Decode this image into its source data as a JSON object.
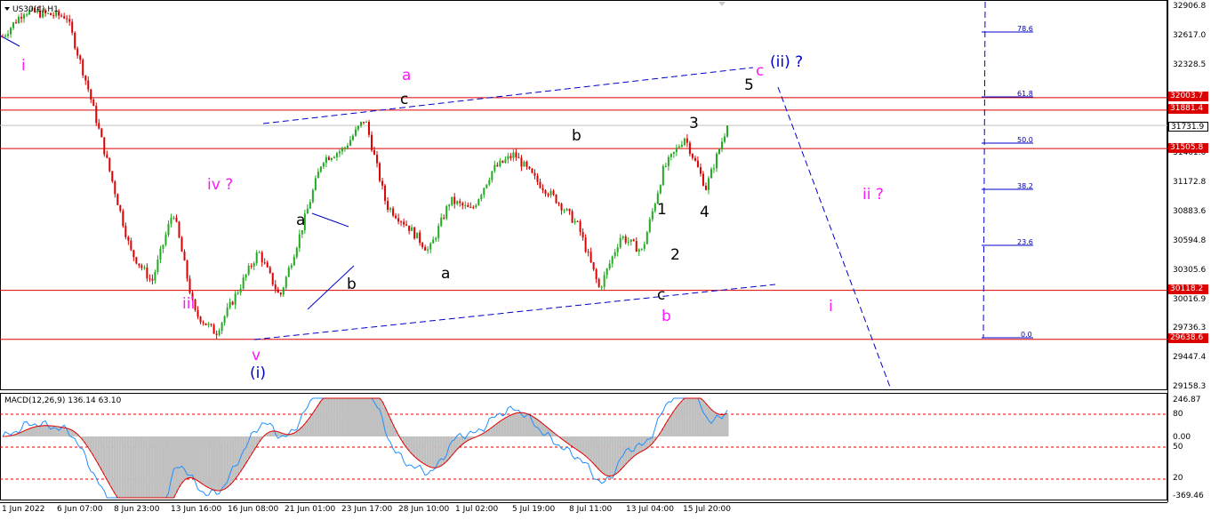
{
  "window": {
    "symbol_title": "US30(€),H1"
  },
  "price_axis": {
    "ticks": [
      "32906.8",
      "32617.0",
      "32328.5",
      "31461.6",
      "31172.8",
      "30883.6",
      "30594.8",
      "30305.6",
      "30016.9",
      "29736.3",
      "29447.4",
      "29158.3"
    ],
    "tags": [
      {
        "text": "32003.7",
        "color": "#dd0000"
      },
      {
        "text": "31881.4",
        "color": "#dd0000"
      },
      {
        "text": "31731.9",
        "color": "#ffffff",
        "text_color": "#000000"
      },
      {
        "text": "31505.8",
        "color": "#dd0000"
      },
      {
        "text": "30118.2",
        "color": "#dd0000"
      },
      {
        "text": "29638.6",
        "color": "#dd0000"
      }
    ]
  },
  "time_axis": {
    "ticks": [
      "1 Jun 2022",
      "6 Jun 07:00",
      "8 Jun 23:00",
      "13 Jun 16:00",
      "16 Jun 08:00",
      "21 Jun 01:00",
      "23 Jun 17:00",
      "28 Jun 10:00",
      "1 Jul 02:00",
      "5 Jul 19:00",
      "8 Jul 11:00",
      "13 Jul 04:00",
      "15 Jul 20:00"
    ]
  },
  "fibonacci": {
    "levels": [
      "78.6",
      "61.8",
      "50.0",
      "38.2",
      "23.6",
      "0.0"
    ]
  },
  "macd": {
    "title": "MACD(12,26,9) 136.14 63.10",
    "ticks": [
      "246.87",
      "80",
      "0.00",
      "50",
      "20",
      "-369.46"
    ]
  },
  "wave_labels": {
    "i_top": "i",
    "iii": "iii",
    "iv_q": "iv ?",
    "v": "v",
    "wave_i_paren": "(i)",
    "a_small_1": "a",
    "b_small_1": "b",
    "a_m": "a",
    "c_top": "c",
    "a_small_2": "a",
    "b_mid": "b",
    "n1": "1",
    "n2": "2",
    "n3": "3",
    "n4": "4",
    "n5": "5",
    "c_low": "c",
    "b_m": "b",
    "c_m_top": "c",
    "ii_paren_q": "(ii) ?",
    "ii_q": "ii ?",
    "i_right": "i"
  },
  "colors": {
    "bull": "#22aa22",
    "bear": "#dd0000",
    "support_resistance": "#dd0000",
    "trendline": "#0000cc",
    "macd_line": "#1e90ff",
    "signal_line": "#dd0000",
    "histogram": "#c0c0c0"
  },
  "chart_data": {
    "type": "candlestick",
    "title": "US30(€),H1",
    "price_range": [
      29158.3,
      32906.8
    ],
    "horizontal_levels": [
      32003.7,
      31881.4,
      31505.8,
      30118.2,
      29638.6
    ],
    "current_price": 31731.9,
    "close_path": [
      {
        "t": "1 Jun 2022",
        "p": 32600
      },
      {
        "t": "3 Jun",
        "p": 32850
      },
      {
        "t": "6 Jun 07:00",
        "p": 32820
      },
      {
        "t": "7 Jun",
        "p": 32800
      },
      {
        "t": "8 Jun 23:00",
        "p": 32100
      },
      {
        "t": "10 Jun",
        "p": 31300
      },
      {
        "t": "13 Jun 16:00",
        "p": 30500
      },
      {
        "t": "14 Jun",
        "p": 30200
      },
      {
        "t": "15 Jun",
        "p": 30900
      },
      {
        "t": "16 Jun 08:00",
        "p": 29900
      },
      {
        "t": "17 Jun",
        "p": 29700
      },
      {
        "t": "20 Jun",
        "p": 30100
      },
      {
        "t": "21 Jun 01:00",
        "p": 30500
      },
      {
        "t": "22 Jun",
        "p": 30050
      },
      {
        "t": "23 Jun 17:00",
        "p": 30700
      },
      {
        "t": "24 Jun",
        "p": 31400
      },
      {
        "t": "27 Jun",
        "p": 31500
      },
      {
        "t": "28 Jun 10:00",
        "p": 31800
      },
      {
        "t": "29 Jun",
        "p": 30950
      },
      {
        "t": "30 Jun",
        "p": 30750
      },
      {
        "t": "1 Jul 02:00",
        "p": 30500
      },
      {
        "t": "4 Jul",
        "p": 31000
      },
      {
        "t": "5 Jul 19:00",
        "p": 30900
      },
      {
        "t": "6 Jul",
        "p": 31300
      },
      {
        "t": "8 Jul 11:00",
        "p": 31450
      },
      {
        "t": "11 Jul",
        "p": 31200
      },
      {
        "t": "12 Jul",
        "p": 31000
      },
      {
        "t": "13 Jul 04:00",
        "p": 30750
      },
      {
        "t": "13 Jul",
        "p": 30130
      },
      {
        "t": "14 Jul",
        "p": 30650
      },
      {
        "t": "14 Jul b",
        "p": 30500
      },
      {
        "t": "15 Jul 20:00",
        "p": 31300
      },
      {
        "t": "16 Jul",
        "p": 31620
      },
      {
        "t": "18 Jul",
        "p": 31120
      },
      {
        "t": "19 Jul",
        "p": 31731.9
      }
    ]
  }
}
